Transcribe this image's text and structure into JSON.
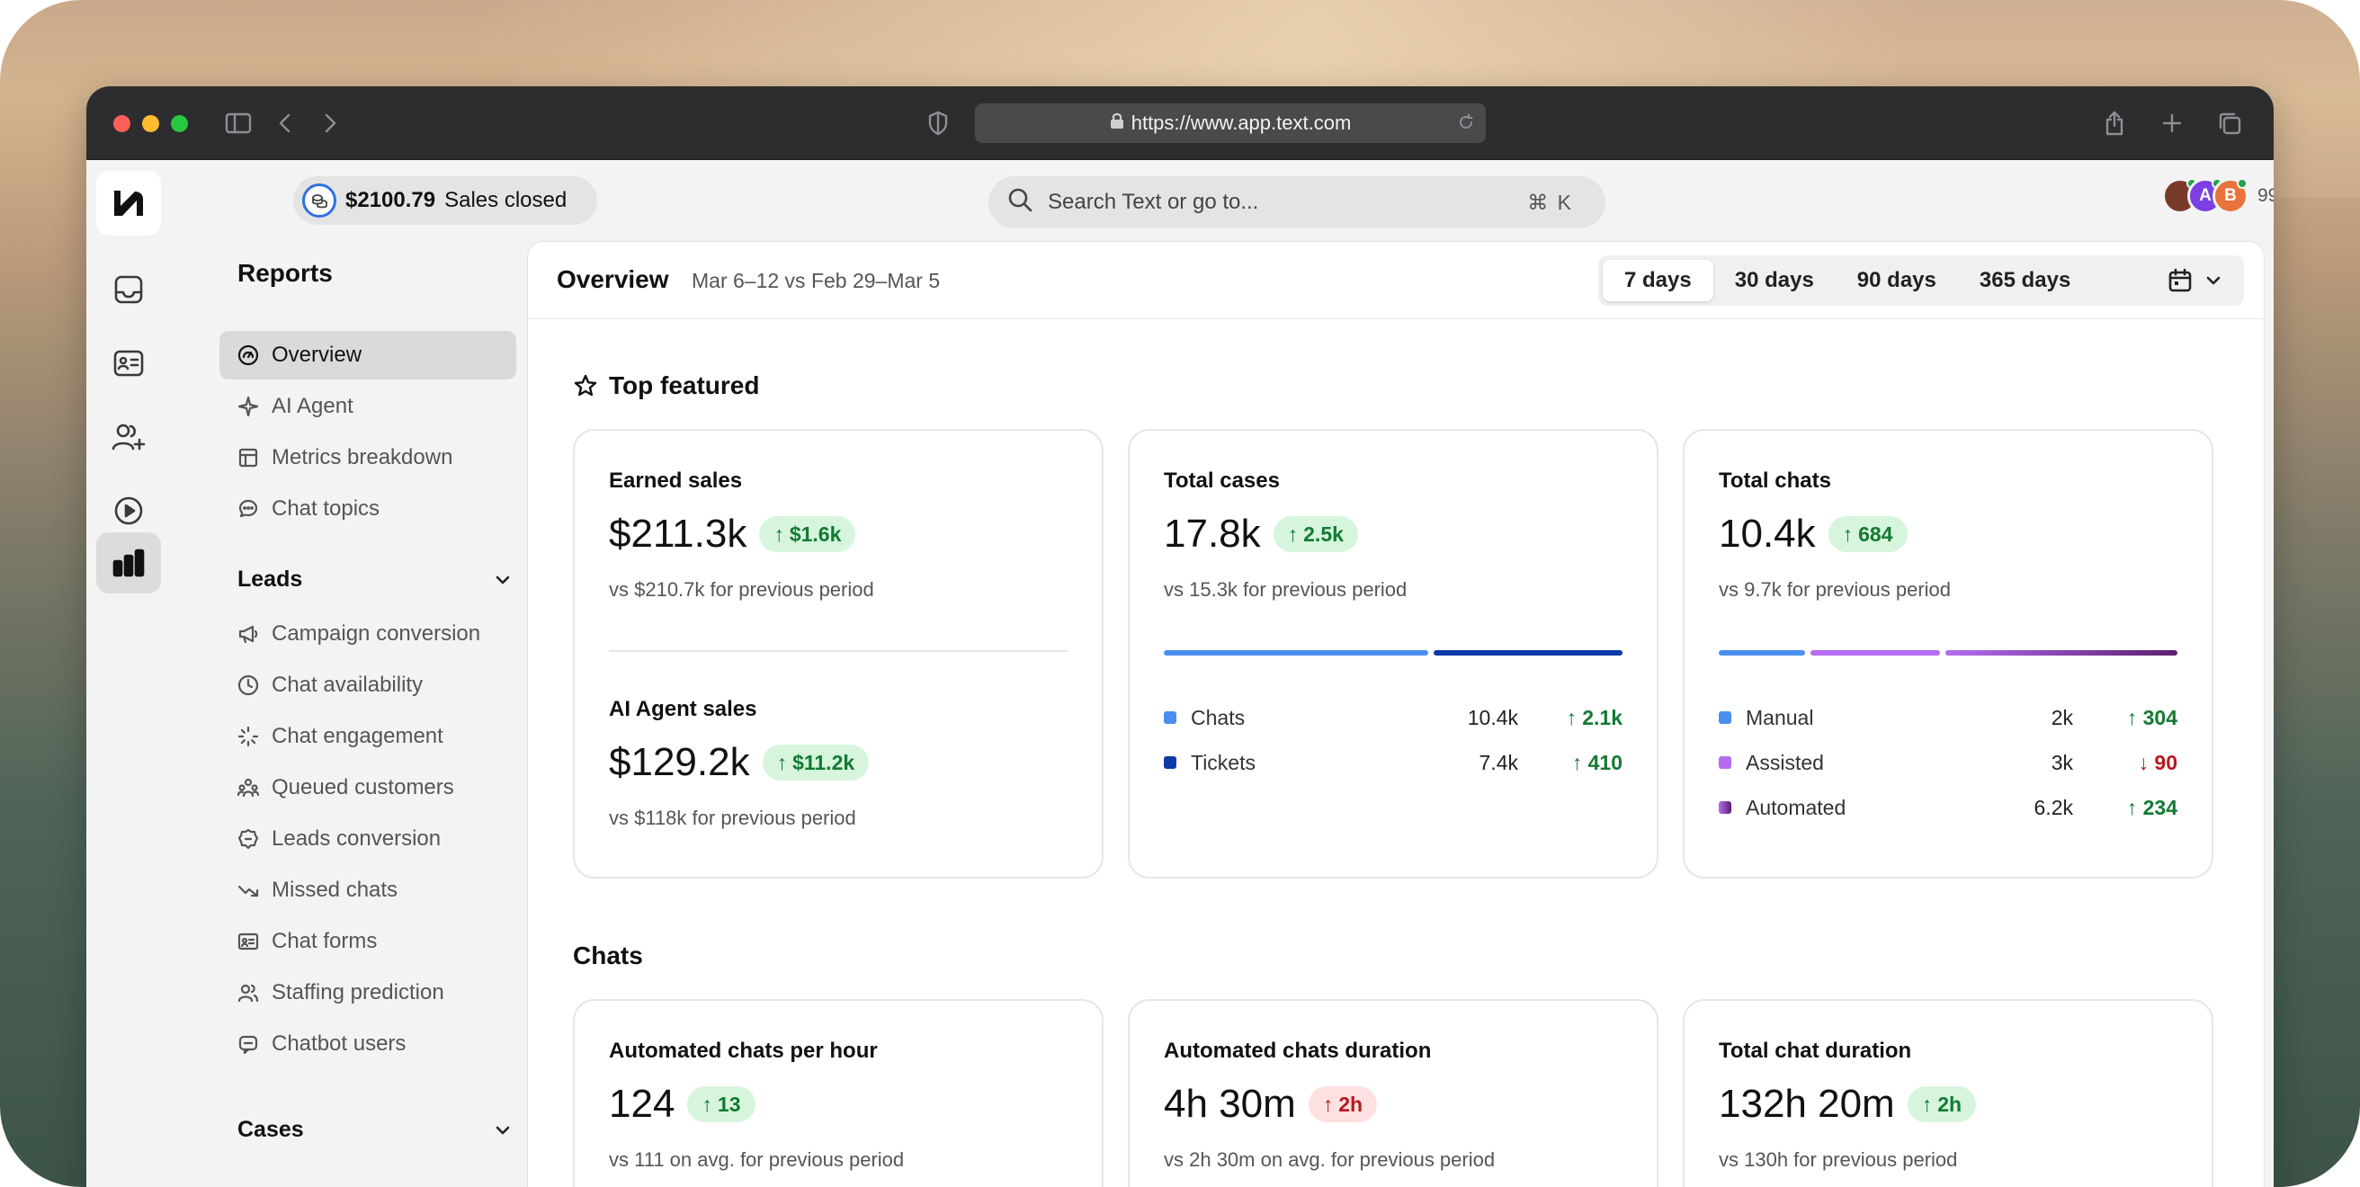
{
  "browser": {
    "url": "https://www.app.text.com"
  },
  "topbar": {
    "sales_amount": "$2100.79",
    "sales_label": "Sales closed",
    "search_placeholder": "Search Text or go to...",
    "search_shortcut": "⌘ K",
    "avatars": [
      {
        "initial": "",
        "color": "#7a3a2a"
      },
      {
        "initial": "A",
        "color": "#7b3fe4"
      },
      {
        "initial": "B",
        "color": "#e8743b"
      }
    ],
    "avatar_count": "99"
  },
  "sidenav": {
    "title": "Reports",
    "reports_items": [
      {
        "label": "Overview",
        "icon": "gauge-icon",
        "active": true
      },
      {
        "label": "AI Agent",
        "icon": "sparkle-icon"
      },
      {
        "label": "Metrics breakdown",
        "icon": "table-icon"
      },
      {
        "label": "Chat topics",
        "icon": "chat-bubble-icon"
      }
    ],
    "leads_title": "Leads",
    "leads_items": [
      {
        "label": "Campaign conversion",
        "icon": "megaphone-icon"
      },
      {
        "label": "Chat availability",
        "icon": "clock-icon"
      },
      {
        "label": "Chat engagement",
        "icon": "loader-icon"
      },
      {
        "label": "Queued customers",
        "icon": "users-queue-icon"
      },
      {
        "label": "Leads conversion",
        "icon": "badge-icon"
      },
      {
        "label": "Missed chats",
        "icon": "trend-down-icon"
      },
      {
        "label": "Chat forms",
        "icon": "form-icon"
      },
      {
        "label": "Staffing prediction",
        "icon": "people-icon"
      },
      {
        "label": "Chatbot users",
        "icon": "bot-icon"
      }
    ],
    "cases_title": "Cases"
  },
  "main": {
    "title": "Overview",
    "date_range": "Mar 6–12 vs Feb 29–Mar 5",
    "range_tabs": [
      "7 days",
      "30 days",
      "90 days",
      "365 days"
    ],
    "active_range": "7 days",
    "top_featured_title": "Top featured",
    "chats_title": "Chats"
  },
  "cards": {
    "earned_sales": {
      "label": "Earned sales",
      "value": "$211.3k",
      "delta": "$1.6k",
      "sub": "vs $210.7k for previous period"
    },
    "ai_agent_sales": {
      "label": "AI Agent sales",
      "value": "$129.2k",
      "delta": "$11.2k",
      "sub": "vs $118k for previous period"
    },
    "total_cases": {
      "label": "Total cases",
      "value": "17.8k",
      "delta": "2.5k",
      "sub": "vs 15.3k for previous period",
      "breakdown": [
        {
          "name": "Chats",
          "value": "10.4k",
          "delta": "2.1k",
          "direction": "up",
          "color": "#4a8ff0",
          "share": 0.584
        },
        {
          "name": "Tickets",
          "value": "7.4k",
          "delta": "410",
          "direction": "up",
          "color": "#0d3aa8",
          "share": 0.416
        }
      ]
    },
    "total_chats": {
      "label": "Total chats",
      "value": "10.4k",
      "delta": "684",
      "sub": "vs 9.7k for previous period",
      "breakdown": [
        {
          "name": "Manual",
          "value": "2k",
          "delta": "304",
          "direction": "up",
          "color": "#4a8ff0",
          "share": 0.193
        },
        {
          "name": "Assisted",
          "value": "3k",
          "delta": "90",
          "direction": "down",
          "color": "#b56cf0",
          "share": 0.289
        },
        {
          "name": "Automated",
          "value": "6.2k",
          "delta": "234",
          "direction": "up",
          "color": "#7a2e8c",
          "share": 0.518
        }
      ]
    },
    "automated_chats_per_hour": {
      "label": "Automated chats per hour",
      "value": "124",
      "delta": "13",
      "direction": "up",
      "sub": "vs 111 on avg. for previous period"
    },
    "automated_chats_duration": {
      "label": "Automated chats duration",
      "value": "4h 30m",
      "delta": "2h",
      "direction": "down",
      "sub": "vs 2h 30m on avg. for previous period"
    },
    "total_chat_duration": {
      "label": "Total chat duration",
      "value": "132h 20m",
      "delta": "2h",
      "direction": "up",
      "sub": "vs 130h for previous period"
    }
  }
}
